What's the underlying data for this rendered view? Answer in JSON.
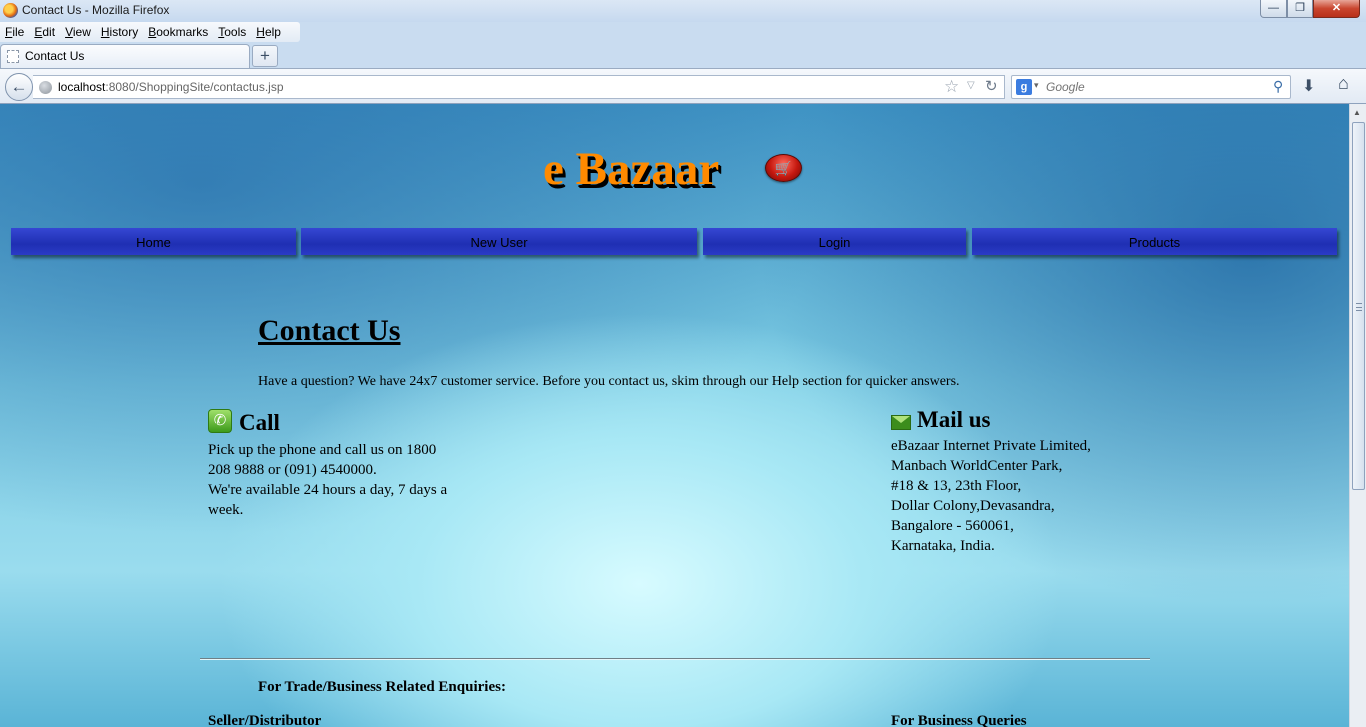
{
  "window": {
    "title": "Contact Us - Mozilla Firefox",
    "min": "—",
    "max": "❐",
    "close": "✕"
  },
  "menubar": {
    "items": [
      "File",
      "Edit",
      "View",
      "History",
      "Bookmarks",
      "Tools",
      "Help"
    ],
    "accelerators": [
      "F",
      "E",
      "V",
      "H",
      "B",
      "T",
      "H"
    ]
  },
  "tab": {
    "label": "Contact Us",
    "new_tab": "+"
  },
  "nav": {
    "back": "←",
    "url_host": "localhost",
    "url_rest": ":8080/ShoppingSite/contactus.jsp",
    "star": "☆",
    "dropdown": "▽",
    "reload": "↻",
    "search_engine": "g",
    "search_placeholder": "Google",
    "search_go": "⚲",
    "downloads": "⬇",
    "home": "⌂"
  },
  "site": {
    "logo": "e Bazaar",
    "cart_icon": "🛒",
    "menu": [
      "Home",
      "New User",
      "Login",
      "Products"
    ]
  },
  "contact": {
    "heading": "Contact Us",
    "intro": "Have a question? We have 24x7 customer service. Before you contact us, skim through our Help section for quicker answers.",
    "call": {
      "title": "Call",
      "icon": "✆",
      "lines": [
        "Pick up the phone and call us on 1800",
        "208 9888 or (091) 4540000.",
        "We're available 24 hours a day, 7 days a",
        "week."
      ]
    },
    "mail": {
      "title": "Mail us",
      "lines": [
        "eBazaar Internet Private Limited,",
        "Manbach WorldCenter Park,",
        "#18 & 13, 23th Floor,",
        "Dollar Colony,Devasandra,",
        "Bangalore - 560061,",
        "Karnataka, India."
      ]
    },
    "trade_heading": "For Trade/Business Related Enquiries:",
    "seller_heading": "Seller/Distributor",
    "business_heading": "For Business Queries"
  },
  "colors": {
    "logo": "#ff8a00",
    "menu_bar": "#2436c0",
    "page_bg": "#7ccbe3"
  }
}
